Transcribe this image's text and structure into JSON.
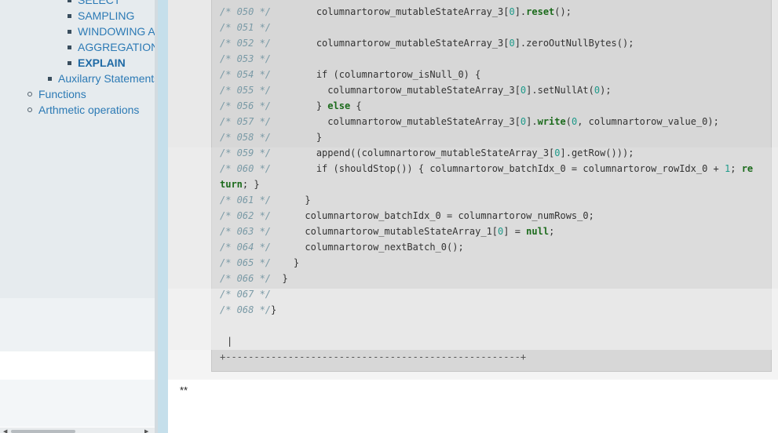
{
  "sidebar": {
    "items": [
      {
        "label": "SELECT"
      },
      {
        "label": "SAMPLING"
      },
      {
        "label": "WINDOWING AND ANALYTICS"
      },
      {
        "label": "AGGREGATIONS"
      },
      {
        "label": "EXPLAIN"
      },
      {
        "label": "Auxilarry Statements"
      },
      {
        "label": "Functions"
      },
      {
        "label": "Arthmetic operations"
      }
    ]
  },
  "code": {
    "lines": [
      {
        "n": "/* 050 */",
        "parts": [
          [
            "",
            "        columnartorow_mutableStateArray_3["
          ],
          [
            "num",
            "0"
          ],
          [
            "",
            "]."
          ],
          [
            "kw",
            "reset"
          ],
          [
            "",
            "();"
          ]
        ]
      },
      {
        "n": "/* 051 */",
        "parts": []
      },
      {
        "n": "/* 052 */",
        "parts": [
          [
            "",
            "        columnartorow_mutableStateArray_3["
          ],
          [
            "num",
            "0"
          ],
          [
            "",
            "].zeroOutNullBytes();"
          ]
        ]
      },
      {
        "n": "/* 053 */",
        "parts": []
      },
      {
        "n": "/* 054 */",
        "parts": [
          [
            "",
            "        if (columnartorow_isNull_0) {"
          ]
        ]
      },
      {
        "n": "/* 055 */",
        "parts": [
          [
            "",
            "          columnartorow_mutableStateArray_3["
          ],
          [
            "num",
            "0"
          ],
          [
            "",
            "].setNullAt("
          ],
          [
            "num",
            "0"
          ],
          [
            "",
            ");"
          ]
        ]
      },
      {
        "n": "/* 056 */",
        "parts": [
          [
            "",
            "        } "
          ],
          [
            "kw",
            "else"
          ],
          [
            "",
            " {"
          ]
        ]
      },
      {
        "n": "/* 057 */",
        "parts": [
          [
            "",
            "          columnartorow_mutableStateArray_3["
          ],
          [
            "num",
            "0"
          ],
          [
            "",
            "]."
          ],
          [
            "kw",
            "write"
          ],
          [
            "",
            "("
          ],
          [
            "num",
            "0"
          ],
          [
            "",
            ", columnartorow_value_0);"
          ]
        ]
      },
      {
        "n": "/* 058 */",
        "parts": [
          [
            "",
            "        }"
          ]
        ]
      },
      {
        "n": "/* 059 */",
        "parts": [
          [
            "",
            "        append((columnartorow_mutableStateArray_3["
          ],
          [
            "num",
            "0"
          ],
          [
            "",
            "].getRow()));"
          ]
        ]
      },
      {
        "n": "/* 060 */",
        "parts": [
          [
            "",
            "        if (shouldStop()) { columnartorow_batchIdx_0 = columnartorow_rowIdx_0 + "
          ],
          [
            "num",
            "1"
          ],
          [
            "",
            "; "
          ],
          [
            "kw",
            "re"
          ]
        ]
      },
      {
        "n": "",
        "parts": [
          [
            "kw",
            "turn"
          ],
          [
            "",
            "; }"
          ]
        ]
      },
      {
        "n": "/* 061 */",
        "parts": [
          [
            "",
            "      }"
          ]
        ]
      },
      {
        "n": "/* 062 */",
        "parts": [
          [
            "",
            "      columnartorow_batchIdx_0 = columnartorow_numRows_0;"
          ]
        ]
      },
      {
        "n": "/* 063 */",
        "parts": [
          [
            "",
            "      columnartorow_mutableStateArray_1["
          ],
          [
            "num",
            "0"
          ],
          [
            "",
            "] = "
          ],
          [
            "kw",
            "null"
          ],
          [
            "",
            ";"
          ]
        ]
      },
      {
        "n": "/* 064 */",
        "parts": [
          [
            "",
            "      columnartorow_nextBatch_0();"
          ]
        ]
      },
      {
        "n": "/* 065 */",
        "parts": [
          [
            "",
            "    }"
          ]
        ]
      },
      {
        "n": "/* 066 */",
        "parts": [
          [
            "",
            "  }"
          ]
        ]
      },
      {
        "n": "/* 067 */",
        "parts": []
      },
      {
        "n": "/* 068 */",
        "parts": [
          [
            "",
            "}"
          ]
        ]
      }
    ],
    "caret": "|",
    "border": "+----------------------------------------------------+"
  },
  "footer_text": "**"
}
